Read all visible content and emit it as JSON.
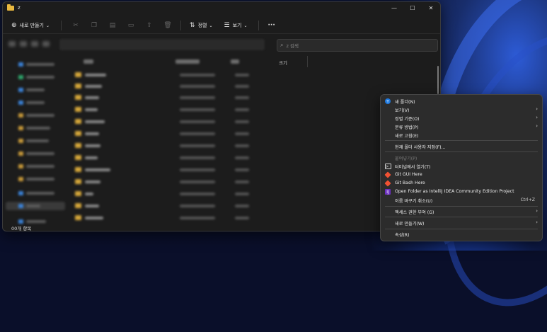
{
  "window": {
    "title": "z"
  },
  "titlebar": {
    "minimize": "—",
    "maximize": "☐",
    "close": "✕"
  },
  "toolbar": {
    "new_label": "새로 만들기",
    "sort_label": "정렬",
    "view_label": "보기",
    "more_label": "···"
  },
  "search": {
    "placeholder": "z 검색"
  },
  "list": {
    "size_header": "크기"
  },
  "status": {
    "text": "00개 항목"
  },
  "context_menu": {
    "items": [
      {
        "label": "새 폴더(N)"
      },
      {
        "label": "보기(V)"
      },
      {
        "label": "정렬 기준(O)"
      },
      {
        "label": "분류 방법(P)"
      },
      {
        "label": "새로 고침(E)"
      },
      {
        "label": "현재 폴더 사용자 지정(F)..."
      },
      {
        "label": "붙여넣기(P)"
      },
      {
        "label": "터미널에서 열기(T)"
      },
      {
        "label": "Git GUI Here"
      },
      {
        "label": "Git Bash Here"
      },
      {
        "label": "Open Folder as IntelliJ IDEA Community Edition Project"
      },
      {
        "label": "이름 바꾸기 취소(U)",
        "shortcut": "Ctrl+Z"
      },
      {
        "label": "액세스 권한 부여 (G)"
      },
      {
        "label": "새로 만들기(W)"
      },
      {
        "label": "속성(R)"
      }
    ]
  }
}
